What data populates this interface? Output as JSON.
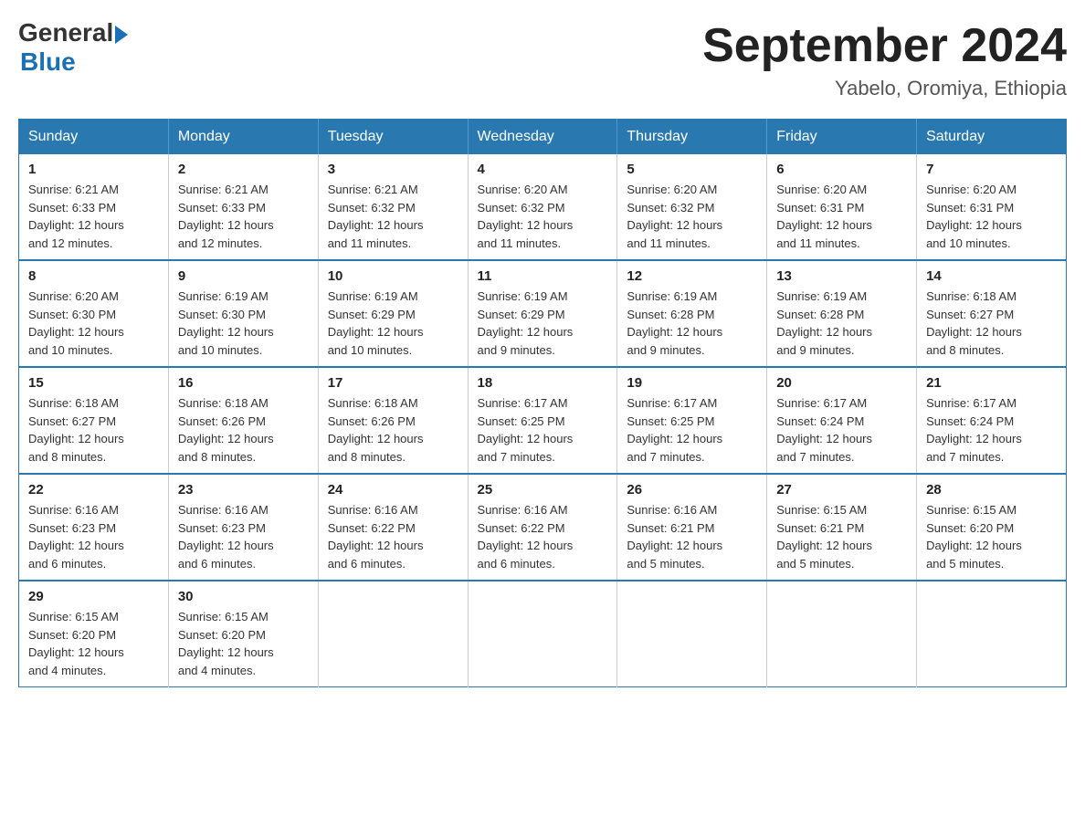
{
  "logo": {
    "general": "General",
    "blue": "Blue"
  },
  "title": "September 2024",
  "subtitle": "Yabelo, Oromiya, Ethiopia",
  "weekdays": [
    "Sunday",
    "Monday",
    "Tuesday",
    "Wednesday",
    "Thursday",
    "Friday",
    "Saturday"
  ],
  "weeks": [
    [
      {
        "day": "1",
        "sunrise": "6:21 AM",
        "sunset": "6:33 PM",
        "daylight": "12 hours and 12 minutes."
      },
      {
        "day": "2",
        "sunrise": "6:21 AM",
        "sunset": "6:33 PM",
        "daylight": "12 hours and 12 minutes."
      },
      {
        "day": "3",
        "sunrise": "6:21 AM",
        "sunset": "6:32 PM",
        "daylight": "12 hours and 11 minutes."
      },
      {
        "day": "4",
        "sunrise": "6:20 AM",
        "sunset": "6:32 PM",
        "daylight": "12 hours and 11 minutes."
      },
      {
        "day": "5",
        "sunrise": "6:20 AM",
        "sunset": "6:32 PM",
        "daylight": "12 hours and 11 minutes."
      },
      {
        "day": "6",
        "sunrise": "6:20 AM",
        "sunset": "6:31 PM",
        "daylight": "12 hours and 11 minutes."
      },
      {
        "day": "7",
        "sunrise": "6:20 AM",
        "sunset": "6:31 PM",
        "daylight": "12 hours and 10 minutes."
      }
    ],
    [
      {
        "day": "8",
        "sunrise": "6:20 AM",
        "sunset": "6:30 PM",
        "daylight": "12 hours and 10 minutes."
      },
      {
        "day": "9",
        "sunrise": "6:19 AM",
        "sunset": "6:30 PM",
        "daylight": "12 hours and 10 minutes."
      },
      {
        "day": "10",
        "sunrise": "6:19 AM",
        "sunset": "6:29 PM",
        "daylight": "12 hours and 10 minutes."
      },
      {
        "day": "11",
        "sunrise": "6:19 AM",
        "sunset": "6:29 PM",
        "daylight": "12 hours and 9 minutes."
      },
      {
        "day": "12",
        "sunrise": "6:19 AM",
        "sunset": "6:28 PM",
        "daylight": "12 hours and 9 minutes."
      },
      {
        "day": "13",
        "sunrise": "6:19 AM",
        "sunset": "6:28 PM",
        "daylight": "12 hours and 9 minutes."
      },
      {
        "day": "14",
        "sunrise": "6:18 AM",
        "sunset": "6:27 PM",
        "daylight": "12 hours and 8 minutes."
      }
    ],
    [
      {
        "day": "15",
        "sunrise": "6:18 AM",
        "sunset": "6:27 PM",
        "daylight": "12 hours and 8 minutes."
      },
      {
        "day": "16",
        "sunrise": "6:18 AM",
        "sunset": "6:26 PM",
        "daylight": "12 hours and 8 minutes."
      },
      {
        "day": "17",
        "sunrise": "6:18 AM",
        "sunset": "6:26 PM",
        "daylight": "12 hours and 8 minutes."
      },
      {
        "day": "18",
        "sunrise": "6:17 AM",
        "sunset": "6:25 PM",
        "daylight": "12 hours and 7 minutes."
      },
      {
        "day": "19",
        "sunrise": "6:17 AM",
        "sunset": "6:25 PM",
        "daylight": "12 hours and 7 minutes."
      },
      {
        "day": "20",
        "sunrise": "6:17 AM",
        "sunset": "6:24 PM",
        "daylight": "12 hours and 7 minutes."
      },
      {
        "day": "21",
        "sunrise": "6:17 AM",
        "sunset": "6:24 PM",
        "daylight": "12 hours and 7 minutes."
      }
    ],
    [
      {
        "day": "22",
        "sunrise": "6:16 AM",
        "sunset": "6:23 PM",
        "daylight": "12 hours and 6 minutes."
      },
      {
        "day": "23",
        "sunrise": "6:16 AM",
        "sunset": "6:23 PM",
        "daylight": "12 hours and 6 minutes."
      },
      {
        "day": "24",
        "sunrise": "6:16 AM",
        "sunset": "6:22 PM",
        "daylight": "12 hours and 6 minutes."
      },
      {
        "day": "25",
        "sunrise": "6:16 AM",
        "sunset": "6:22 PM",
        "daylight": "12 hours and 6 minutes."
      },
      {
        "day": "26",
        "sunrise": "6:16 AM",
        "sunset": "6:21 PM",
        "daylight": "12 hours and 5 minutes."
      },
      {
        "day": "27",
        "sunrise": "6:15 AM",
        "sunset": "6:21 PM",
        "daylight": "12 hours and 5 minutes."
      },
      {
        "day": "28",
        "sunrise": "6:15 AM",
        "sunset": "6:20 PM",
        "daylight": "12 hours and 5 minutes."
      }
    ],
    [
      {
        "day": "29",
        "sunrise": "6:15 AM",
        "sunset": "6:20 PM",
        "daylight": "12 hours and 4 minutes."
      },
      {
        "day": "30",
        "sunrise": "6:15 AM",
        "sunset": "6:20 PM",
        "daylight": "12 hours and 4 minutes."
      },
      null,
      null,
      null,
      null,
      null
    ]
  ],
  "labels": {
    "sunrise": "Sunrise:",
    "sunset": "Sunset:",
    "daylight": "Daylight:"
  }
}
